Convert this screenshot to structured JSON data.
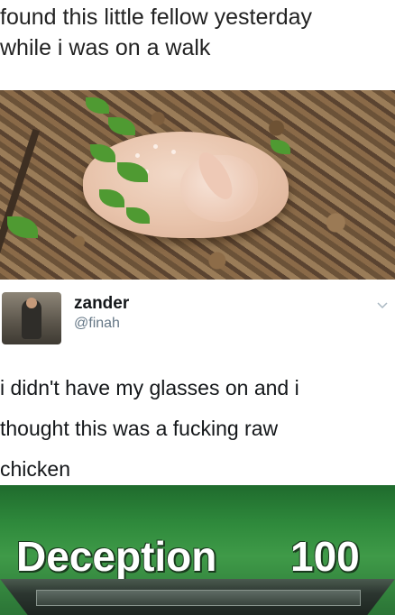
{
  "caption": {
    "line1": "found this little fellow yesterday",
    "line2": "while i was on a walk"
  },
  "tweet": {
    "username": "zander",
    "handle": "@finah",
    "text_lines": [
      "i didn't have my glasses on and i",
      "thought this was a fucking raw",
      "chicken"
    ]
  },
  "banner": {
    "title": "Deception",
    "score": "100"
  },
  "colors": {
    "banner_green": "#2f8a3c",
    "text_dark": "#14171a",
    "handle_gray": "#657786"
  }
}
